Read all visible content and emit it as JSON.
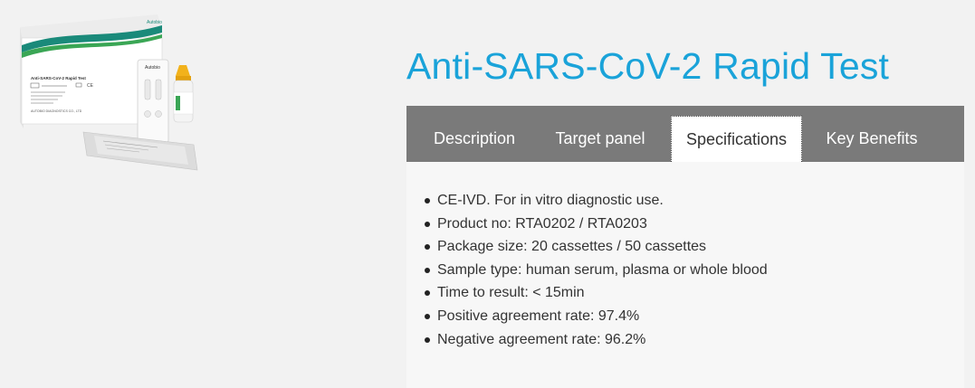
{
  "product": {
    "title": "Anti-SARS-CoV-2 Rapid Test",
    "image": {
      "box_label": "Anti-SARS-CoV-2 Rapid Test",
      "brand_logo_text": "Autobio",
      "company_text": "AUTOBIO DIAGNOSTICS CO., LTD",
      "cassette_brand": "Autobio"
    }
  },
  "tabs": [
    {
      "label": "Description",
      "active": false
    },
    {
      "label": "Target panel",
      "active": false
    },
    {
      "label": "Specifications",
      "active": true
    },
    {
      "label": "Key Benefits",
      "active": false
    }
  ],
  "specifications": [
    "CE-IVD. For in vitro diagnostic use.",
    "Product no: RTA0202 / RTA0203",
    "Package size: 20 cassettes / 50 cassettes",
    "Sample type: human serum, plasma or whole blood",
    "Time to result: < 15min",
    "Positive agreement rate: 97.4%",
    "Negative agreement rate: 96.2%"
  ],
  "colors": {
    "title": "#1aa3d9",
    "tab_bar": "#7a7a7a",
    "box_stripe_teal": "#1a8a7a",
    "box_stripe_green": "#3aa655",
    "vial_cap": "#f2b21b"
  }
}
